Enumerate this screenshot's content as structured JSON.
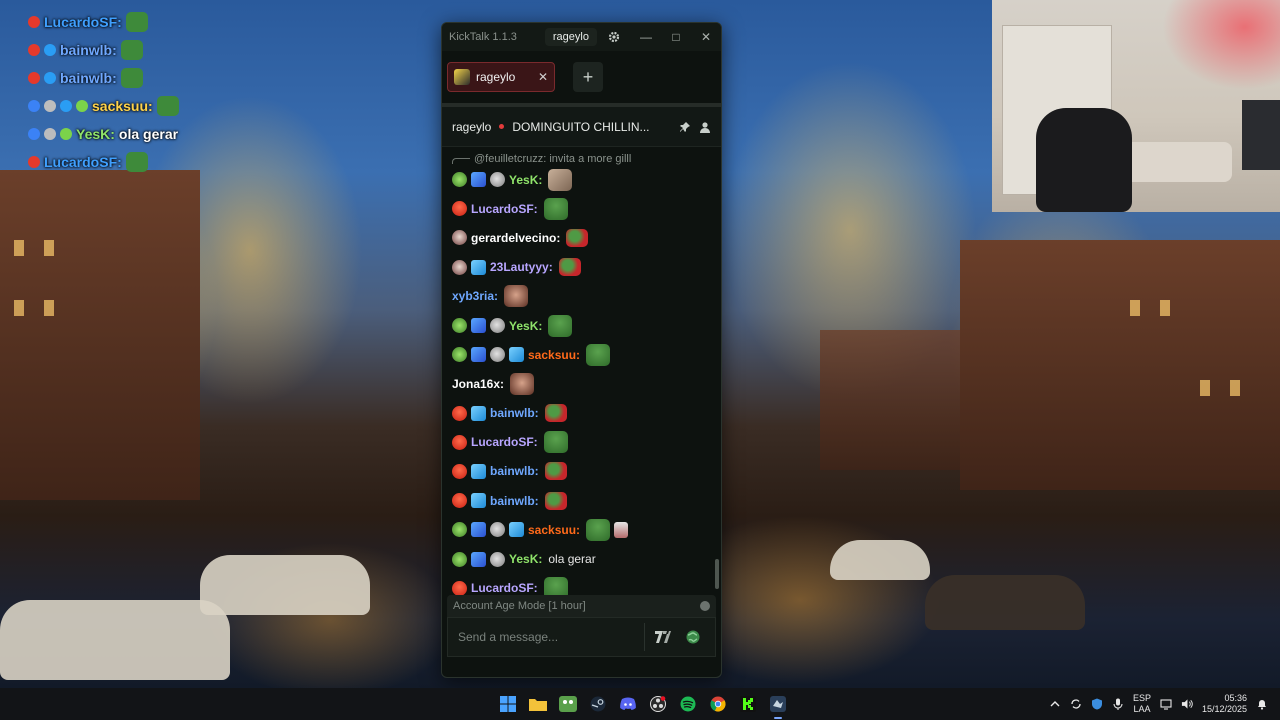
{
  "colors": {
    "accent_red": "#e23b3b",
    "window_bg": "#0d120f",
    "tab_active_bg": "#3a1517",
    "name_white": "#ffffff",
    "name_purple": "#b8a6ff",
    "name_yesk": "#8fe36a",
    "name_orange": "#ff6a1a",
    "name_blue": "#6fa8ff",
    "name_gray": "#c9c9c9"
  },
  "overlay_chat": [
    {
      "name": "LucardoSF:",
      "color": "#3fa0ff",
      "badges": [
        "red"
      ],
      "text": "",
      "emote": true
    },
    {
      "name": "bainwlb:",
      "color": "#6fa8ff",
      "badges": [
        "red",
        "blue"
      ],
      "text": "",
      "emote": true
    },
    {
      "name": "bainwlb:",
      "color": "#6fa8ff",
      "badges": [
        "red",
        "blue"
      ],
      "text": "",
      "emote": true
    },
    {
      "name": "sacksuu:",
      "color": "#ffd34a",
      "badges": [
        "sword",
        "gray",
        "blue",
        "green"
      ],
      "text": "",
      "emote": true
    },
    {
      "name": "YesK:",
      "color": "#8fe36a",
      "badges": [
        "sword",
        "gray",
        "green"
      ],
      "text": "ola gerar",
      "emote": false
    },
    {
      "name": "LucardoSF:",
      "color": "#3fa0ff",
      "badges": [
        "red"
      ],
      "text": "",
      "emote": true
    }
  ],
  "window": {
    "app_title": "KickTalk 1.1.3",
    "user_pill": "rageylo",
    "icons": {
      "settings": "gear-icon",
      "minimize": "minimize-icon",
      "maximize": "maximize-icon",
      "close": "close-icon"
    }
  },
  "tabs": [
    {
      "label": "rageylo",
      "active": true
    }
  ],
  "add_tab_label": "+",
  "channel": {
    "name": "rageylo",
    "title": "DOMINGUITO CHILLIN...",
    "live": true
  },
  "reply_preview": "@feuilletcruzz: invita a more gilll",
  "messages": [
    {
      "name": "YesK:",
      "color": "#8fe36a",
      "badges": [
        "green",
        "sword",
        "gray"
      ],
      "text": "",
      "emotes": [
        "pic"
      ]
    },
    {
      "name": "LucardoSF:",
      "color": "#b8a6ff",
      "badges": [
        "red"
      ],
      "text": "",
      "emotes": [
        "frog"
      ]
    },
    {
      "name": "gerardelvecino:",
      "color": "#ffffff",
      "badges": [
        "skull"
      ],
      "text": "",
      "emotes": [
        "rose"
      ]
    },
    {
      "name": "23Lautyyy:",
      "color": "#b8a6ff",
      "badges": [
        "skull",
        "blue"
      ],
      "text": "",
      "emotes": [
        "rose"
      ]
    },
    {
      "name": "xyb3ria:",
      "color": "#6fa8ff",
      "badges": [],
      "text": "",
      "emotes": [
        "face"
      ]
    },
    {
      "name": "YesK:",
      "color": "#8fe36a",
      "badges": [
        "green",
        "sword",
        "gray"
      ],
      "text": "",
      "emotes": [
        "frog"
      ]
    },
    {
      "name": "sacksuu:",
      "color": "#ff6a1a",
      "badges": [
        "green",
        "sword",
        "gray",
        "blue"
      ],
      "text": "",
      "emotes": [
        "frog"
      ]
    },
    {
      "name": "Jona16x:",
      "color": "#ffffff",
      "badges": [],
      "text": "",
      "emotes": [
        "face"
      ]
    },
    {
      "name": "bainwlb:",
      "color": "#6fa8ff",
      "badges": [
        "red",
        "blue"
      ],
      "text": "",
      "emotes": [
        "rose"
      ]
    },
    {
      "name": "LucardoSF:",
      "color": "#b8a6ff",
      "badges": [
        "red"
      ],
      "text": "",
      "emotes": [
        "frog"
      ]
    },
    {
      "name": "bainwlb:",
      "color": "#6fa8ff",
      "badges": [
        "red",
        "blue"
      ],
      "text": "",
      "emotes": [
        "rose"
      ]
    },
    {
      "name": "bainwlb:",
      "color": "#6fa8ff",
      "badges": [
        "red",
        "blue"
      ],
      "text": "",
      "emotes": [
        "rose"
      ]
    },
    {
      "name": "sacksuu:",
      "color": "#ff6a1a",
      "badges": [
        "green",
        "sword",
        "gray",
        "blue"
      ],
      "text": "",
      "emotes": [
        "frog",
        "small"
      ]
    },
    {
      "name": "YesK:",
      "color": "#8fe36a",
      "badges": [
        "green",
        "sword",
        "gray"
      ],
      "text": "ola gerar",
      "emotes": []
    },
    {
      "name": "LucardoSF:",
      "color": "#b8a6ff",
      "badges": [
        "red"
      ],
      "text": "",
      "emotes": [
        "frog"
      ]
    }
  ],
  "account_age_mode": "Account Age Mode [1 hour]",
  "composer": {
    "placeholder": "Send a message...",
    "icons": {
      "emote_picker": "7tv-icon",
      "kick_emotes": "globe-emote-icon"
    }
  },
  "taskbar": {
    "apps": [
      "windows-start-icon",
      "file-explorer-icon",
      "frog-app-icon",
      "steam-icon",
      "discord-icon",
      "obs-icon",
      "spotify-icon",
      "chrome-icon",
      "kick-icon",
      "steam-active-icon"
    ],
    "tray": {
      "language_top": "ESP",
      "language_bottom": "LAA",
      "time": "05:36",
      "date": "15/12/2025"
    }
  }
}
